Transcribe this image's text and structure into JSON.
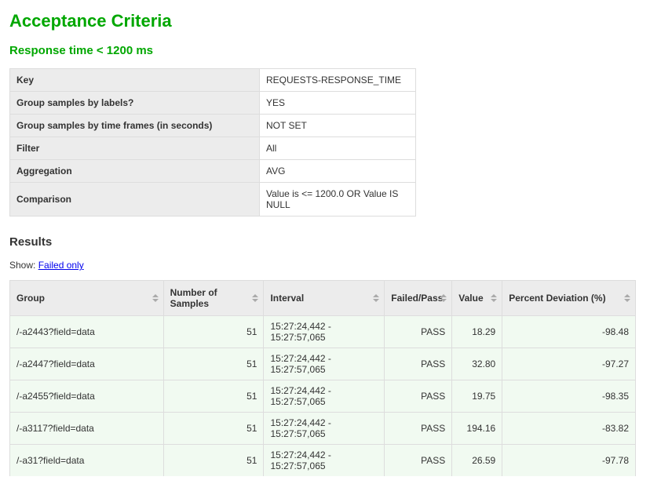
{
  "title": "Acceptance Criteria",
  "subtitle": "Response time < 1200 ms",
  "criteria": {
    "rows": [
      {
        "key": "Key",
        "value": "REQUESTS-RESPONSE_TIME"
      },
      {
        "key": "Group samples by labels?",
        "value": "YES"
      },
      {
        "key": "Group samples by time frames (in seconds)",
        "value": "NOT SET"
      },
      {
        "key": "Filter",
        "value": "All"
      },
      {
        "key": "Aggregation",
        "value": "AVG"
      },
      {
        "key": "Comparison",
        "value": "Value is <= 1200.0 OR Value IS NULL"
      }
    ]
  },
  "results_heading": "Results",
  "show_label": "Show: ",
  "show_link": "Failed only",
  "columns": {
    "group": "Group",
    "samples": "Number of Samples",
    "interval": "Interval",
    "failed_pass": "Failed/Pass",
    "value": "Value",
    "deviation": "Percent Deviation (%)"
  },
  "rows": [
    {
      "group": "/-a2443?field=data",
      "samples": "51",
      "interval": "15:27:24,442 - 15:27:57,065",
      "fp": "PASS",
      "value": "18.29",
      "deviation": "-98.48"
    },
    {
      "group": "/-a2447?field=data",
      "samples": "51",
      "interval": "15:27:24,442 - 15:27:57,065",
      "fp": "PASS",
      "value": "32.80",
      "deviation": "-97.27"
    },
    {
      "group": "/-a2455?field=data",
      "samples": "51",
      "interval": "15:27:24,442 - 15:27:57,065",
      "fp": "PASS",
      "value": "19.75",
      "deviation": "-98.35"
    },
    {
      "group": "/-a3117?field=data",
      "samples": "51",
      "interval": "15:27:24,442 - 15:27:57,065",
      "fp": "PASS",
      "value": "194.16",
      "deviation": "-83.82"
    },
    {
      "group": "/-a31?field=data",
      "samples": "51",
      "interval": "15:27:24,442 - 15:27:57,065",
      "fp": "PASS",
      "value": "26.59",
      "deviation": "-97.78"
    }
  ]
}
